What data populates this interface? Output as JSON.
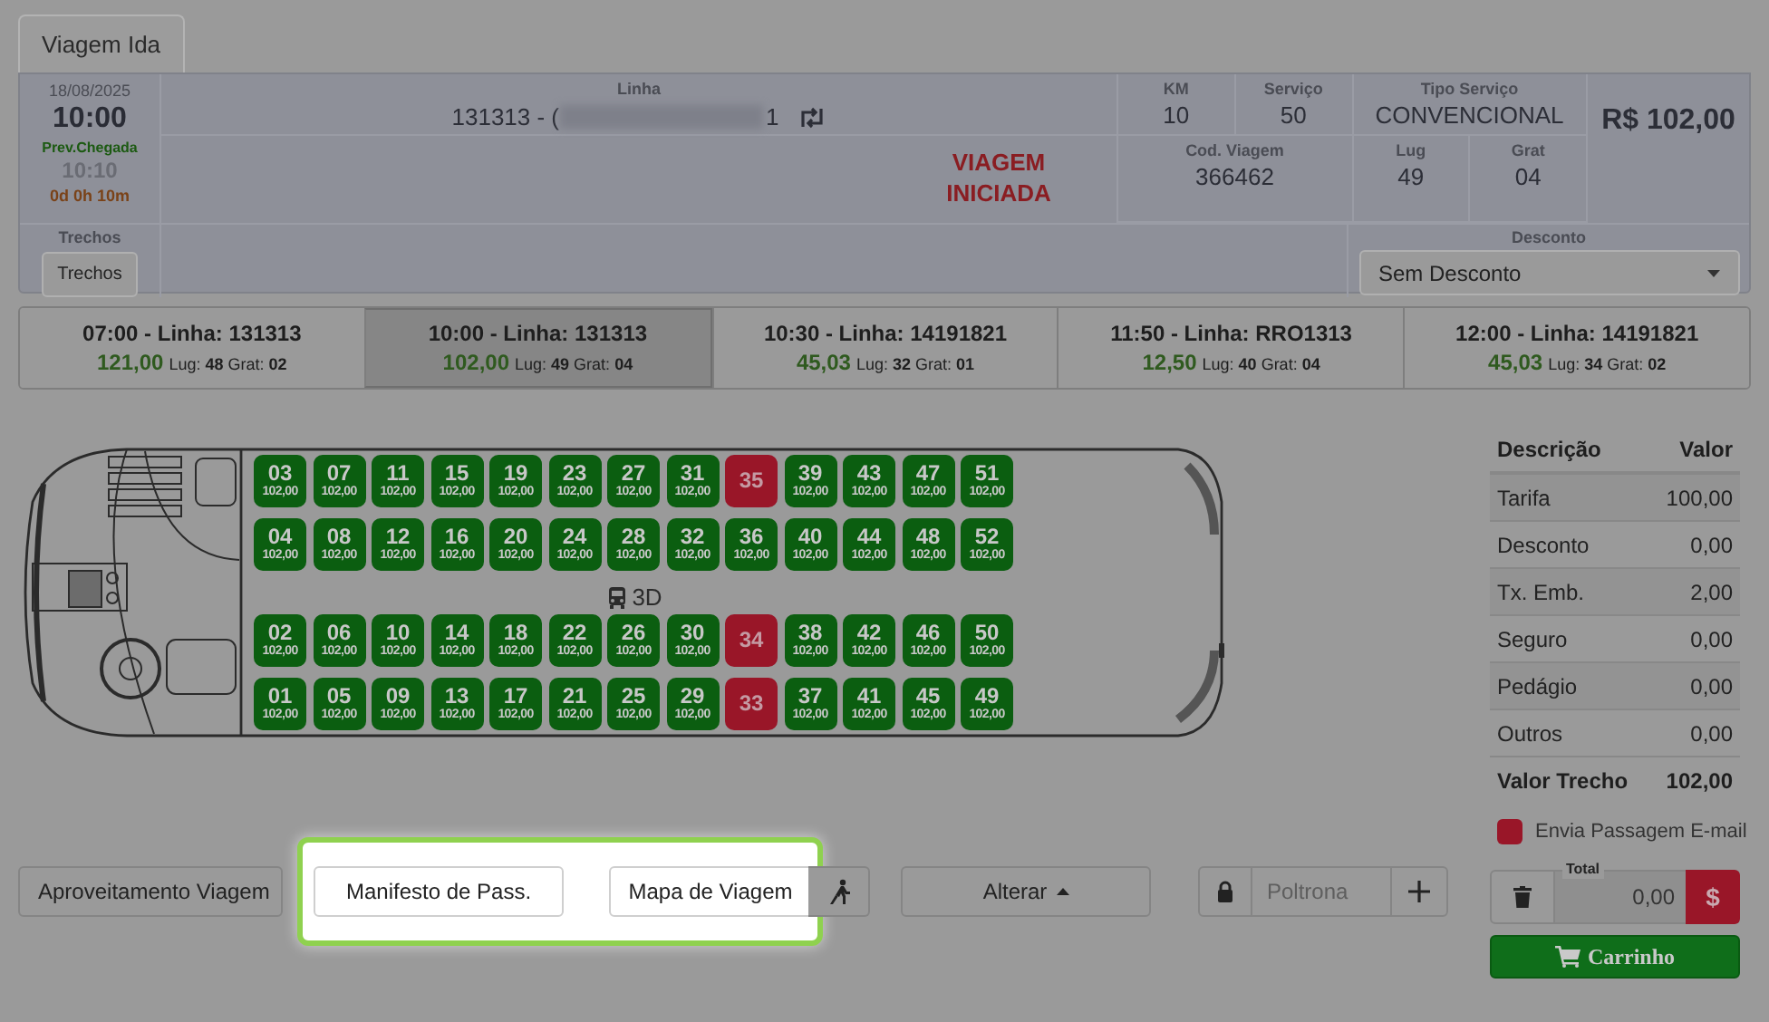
{
  "tabs": [
    {
      "label": "Viagem Ida",
      "selected": true
    }
  ],
  "trip": {
    "date": "18/08/2025",
    "time": "10:00",
    "arrival_label": "Prev.Chegada",
    "arrival_time": "10:10",
    "duration": "0d 0h 10m",
    "line_label": "Linha",
    "line_prefix": "131313 - (",
    "line_suffix": "1",
    "status": "VIAGEM INICIADA",
    "km_label": "KM",
    "km": "10",
    "service_label": "Serviço",
    "service": "50",
    "service_type_label": "Tipo Serviço",
    "service_type": "CONVENCIONAL",
    "price": "R$ 102,00",
    "trip_code_label": "Cod. Viagem",
    "trip_code": "366462",
    "seats_label": "Lug",
    "seats": "49",
    "free_label": "Grat",
    "free": "04",
    "segments_label": "Trechos",
    "segments_button": "Trechos",
    "discount_label": "Desconto",
    "discount": "Sem Desconto"
  },
  "schedules": [
    {
      "title": "07:00 - Linha: 131313",
      "price": "121,00",
      "info": "Lug: **48** Grat: **02**",
      "selected": false
    },
    {
      "title": "10:00 - Linha: 131313",
      "price": "102,00",
      "info": "Lug: **49** Grat: **04**",
      "selected": true
    },
    {
      "title": "10:30 - Linha: 14191821",
      "price": "45,03",
      "info": "Lug: **32** Grat: **01**",
      "selected": false
    },
    {
      "title": "11:50 - Linha: RRO1313",
      "price": "12,50",
      "info": "Lug: **40** Grat: **04**",
      "selected": false
    },
    {
      "title": "12:00 - Linha: 14191821",
      "price": "45,03",
      "info": "Lug: **34** Grat: **02**",
      "selected": false
    }
  ],
  "bus": {
    "deck_label": "3D",
    "rows": [
      {
        "seats": [
          {
            "number": "03",
            "price": "102,00",
            "occupied": false
          },
          {
            "number": "07",
            "price": "102,00",
            "occupied": false
          },
          {
            "number": "11",
            "price": "102,00",
            "occupied": false
          },
          {
            "number": "15",
            "price": "102,00",
            "occupied": false
          },
          {
            "number": "19",
            "price": "102,00",
            "occupied": false
          },
          {
            "number": "23",
            "price": "102,00",
            "occupied": false
          },
          {
            "number": "27",
            "price": "102,00",
            "occupied": false
          },
          {
            "number": "31",
            "price": "102,00",
            "occupied": false
          },
          {
            "number": "35",
            "occupied": true
          },
          {
            "number": "39",
            "price": "102,00",
            "occupied": false
          },
          {
            "number": "43",
            "price": "102,00",
            "occupied": false
          },
          {
            "number": "47",
            "price": "102,00",
            "occupied": false
          },
          {
            "number": "51",
            "price": "102,00",
            "occupied": false
          }
        ]
      },
      {
        "seats": [
          {
            "number": "04",
            "price": "102,00",
            "occupied": false
          },
          {
            "number": "08",
            "price": "102,00",
            "occupied": false
          },
          {
            "number": "12",
            "price": "102,00",
            "occupied": false
          },
          {
            "number": "16",
            "price": "102,00",
            "occupied": false
          },
          {
            "number": "20",
            "price": "102,00",
            "occupied": false
          },
          {
            "number": "24",
            "price": "102,00",
            "occupied": false
          },
          {
            "number": "28",
            "price": "102,00",
            "occupied": false
          },
          {
            "number": "32",
            "price": "102,00",
            "occupied": false
          },
          {
            "number": "36",
            "price": "102,00",
            "occupied": false
          },
          {
            "number": "40",
            "price": "102,00",
            "occupied": false
          },
          {
            "number": "44",
            "price": "102,00",
            "occupied": false
          },
          {
            "number": "48",
            "price": "102,00",
            "occupied": false
          },
          {
            "number": "52",
            "price": "102,00",
            "occupied": false
          }
        ]
      },
      {
        "seats": [
          {
            "number": "02",
            "price": "102,00",
            "occupied": false
          },
          {
            "number": "06",
            "price": "102,00",
            "occupied": false
          },
          {
            "number": "10",
            "price": "102,00",
            "occupied": false
          },
          {
            "number": "14",
            "price": "102,00",
            "occupied": false
          },
          {
            "number": "18",
            "price": "102,00",
            "occupied": false
          },
          {
            "number": "22",
            "price": "102,00",
            "occupied": false
          },
          {
            "number": "26",
            "price": "102,00",
            "occupied": false
          },
          {
            "number": "30",
            "price": "102,00",
            "occupied": false
          },
          {
            "number": "34",
            "occupied": true
          },
          {
            "number": "38",
            "price": "102,00",
            "occupied": false
          },
          {
            "number": "42",
            "price": "102,00",
            "occupied": false
          },
          {
            "number": "46",
            "price": "102,00",
            "occupied": false
          },
          {
            "number": "50",
            "price": "102,00",
            "occupied": false
          }
        ]
      },
      {
        "seats": [
          {
            "number": "01",
            "price": "102,00",
            "occupied": false
          },
          {
            "number": "05",
            "price": "102,00",
            "occupied": false
          },
          {
            "number": "09",
            "price": "102,00",
            "occupied": false
          },
          {
            "number": "13",
            "price": "102,00",
            "occupied": false
          },
          {
            "number": "17",
            "price": "102,00",
            "occupied": false
          },
          {
            "number": "21",
            "price": "102,00",
            "occupied": false
          },
          {
            "number": "25",
            "price": "102,00",
            "occupied": false
          },
          {
            "number": "29",
            "price": "102,00",
            "occupied": false
          },
          {
            "number": "33",
            "occupied": true
          },
          {
            "number": "37",
            "price": "102,00",
            "occupied": false
          },
          {
            "number": "41",
            "price": "102,00",
            "occupied": false
          },
          {
            "number": "45",
            "price": "102,00",
            "occupied": false
          },
          {
            "number": "49",
            "price": "102,00",
            "occupied": false
          }
        ]
      }
    ]
  },
  "fares": {
    "columns": [
      "Descrição",
      "Valor"
    ],
    "rows": [
      {
        "label": "Tarifa",
        "value": "100,00"
      },
      {
        "label": "Desconto",
        "value": "0,00"
      },
      {
        "label": "Tx. Emb.",
        "value": "2,00"
      },
      {
        "label": "Seguro",
        "value": "0,00"
      },
      {
        "label": "Pedágio",
        "value": "0,00"
      },
      {
        "label": "Outros",
        "value": "0,00"
      }
    ],
    "total_label": "Valor Trecho",
    "total": "102,00"
  },
  "email": {
    "label": "Envia Passagem E-mail",
    "checked": false
  },
  "actions": {
    "reuse": "Aproveitamento Viagem",
    "manifest": "Manifesto de Pass.",
    "trip_map": "Mapa de Viagem",
    "change": "Alterar",
    "seat_placeholder": "Poltrona",
    "total_label": "Total",
    "total": "0,00",
    "pay": "$",
    "cart": "Carrinho"
  }
}
